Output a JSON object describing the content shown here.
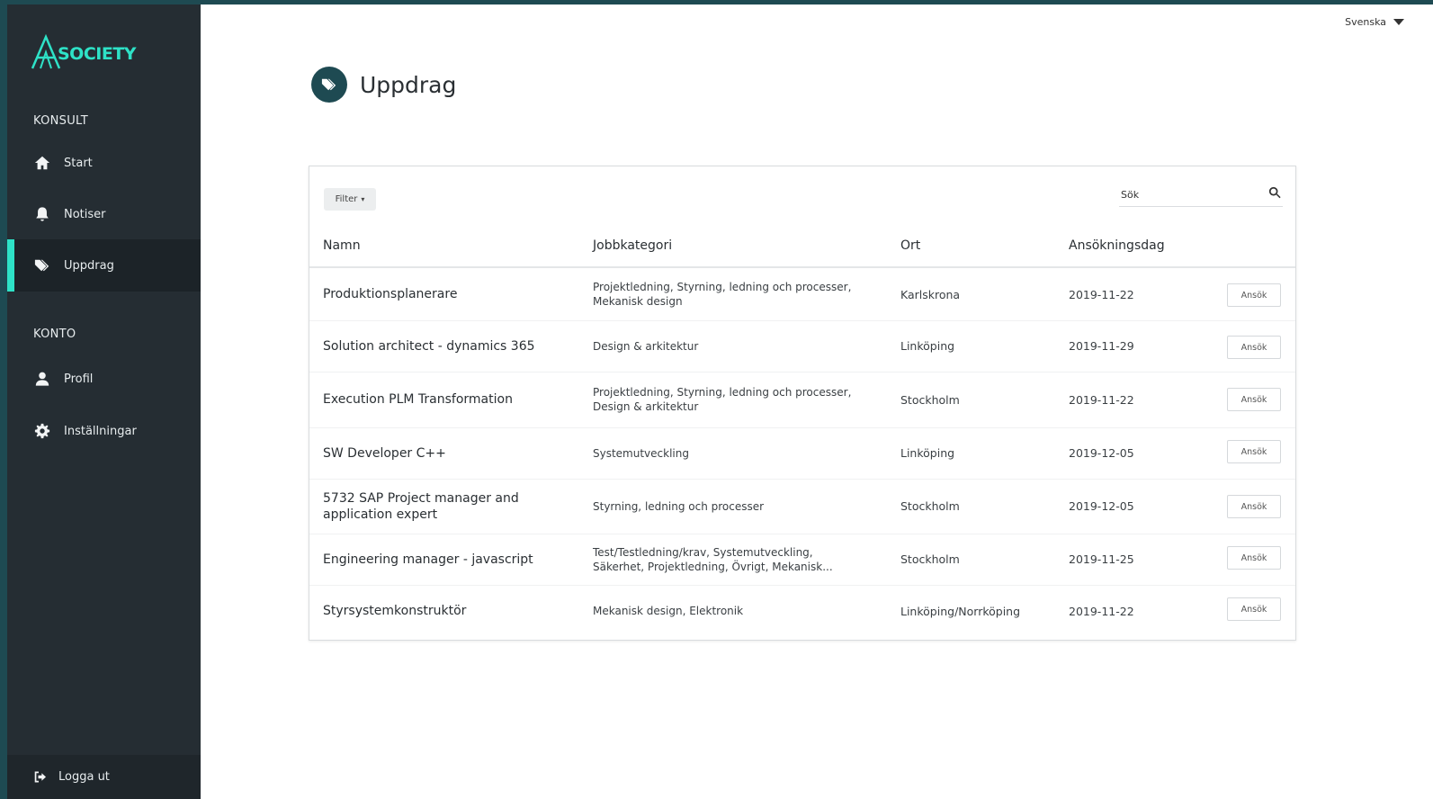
{
  "brand": {
    "logo_text": "SOCIETY"
  },
  "sidebar": {
    "section_konsult": "KONSULT",
    "items_konsult": [
      {
        "label": "Start",
        "icon": "home-icon"
      },
      {
        "label": "Notiser",
        "icon": "bell-icon"
      },
      {
        "label": "Uppdrag",
        "icon": "tags-icon",
        "active": true
      }
    ],
    "section_konto": "KONTO",
    "items_konto": [
      {
        "label": "Profil",
        "icon": "user-icon"
      },
      {
        "label": "Inställningar",
        "icon": "gear-icon"
      }
    ],
    "logout_label": "Logga ut"
  },
  "language": {
    "selected": "Svenska"
  },
  "page": {
    "title": "Uppdrag"
  },
  "toolbar": {
    "filter_label": "Filter",
    "search_placeholder": "Sök"
  },
  "table": {
    "headers": [
      "Namn",
      "Jobbkategori",
      "Ort",
      "Ansökningsdag"
    ],
    "apply_label": "Ansök",
    "rows": [
      {
        "name": "Produktionsplanerare",
        "category": "Projektledning, Styrning, ledning och processer, Mekanisk design",
        "city": "Karlskrona",
        "date": "2019-11-22"
      },
      {
        "name": "Solution architect - dynamics 365",
        "category": "Design & arkitektur",
        "city": "Linköping",
        "date": "2019-11-29"
      },
      {
        "name": "Execution PLM Transformation",
        "category": "Projektledning, Styrning, ledning och processer, Design & arkitektur",
        "city": "Stockholm",
        "date": "2019-11-22"
      },
      {
        "name": "SW Developer C++",
        "category": "Systemutveckling",
        "city": "Linköping",
        "date": "2019-12-05"
      },
      {
        "name": "5732 SAP Project manager and application expert",
        "category": "Styrning, ledning och processer",
        "city": "Stockholm",
        "date": "2019-12-05"
      },
      {
        "name": "Engineering manager - javascript",
        "category": "Test/Testledning/krav, Systemutveckling, Säkerhet, Projektledning, Övrigt, Mekanisk...",
        "city": "Stockholm",
        "date": "2019-11-25"
      },
      {
        "name": "Styrsystemkonstruktör",
        "category": "Mekanisk design, Elektronik",
        "city": "Linköping/Norrköping",
        "date": "2019-11-22"
      }
    ]
  }
}
